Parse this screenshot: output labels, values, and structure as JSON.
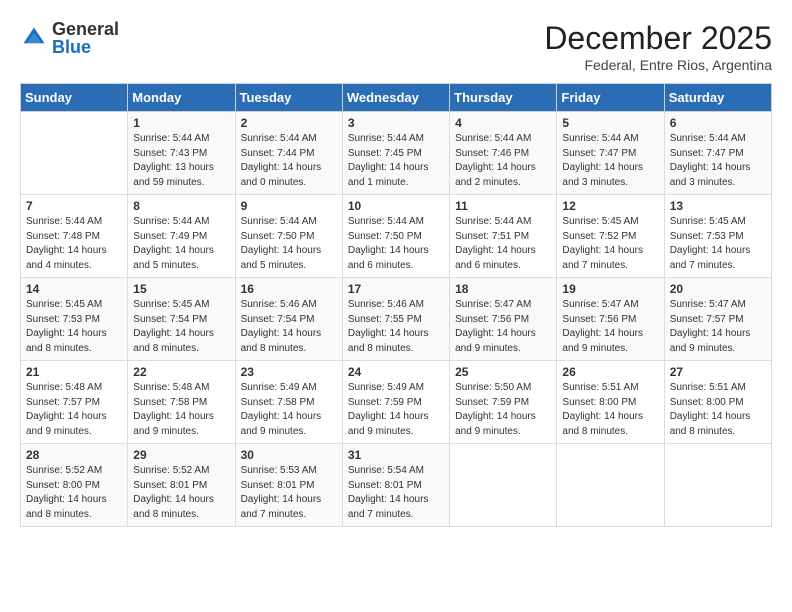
{
  "header": {
    "logo_general": "General",
    "logo_blue": "Blue",
    "month": "December 2025",
    "location": "Federal, Entre Rios, Argentina"
  },
  "days_of_week": [
    "Sunday",
    "Monday",
    "Tuesday",
    "Wednesday",
    "Thursday",
    "Friday",
    "Saturday"
  ],
  "weeks": [
    [
      {
        "day": "",
        "text": ""
      },
      {
        "day": "1",
        "text": "Sunrise: 5:44 AM\nSunset: 7:43 PM\nDaylight: 13 hours\nand 59 minutes."
      },
      {
        "day": "2",
        "text": "Sunrise: 5:44 AM\nSunset: 7:44 PM\nDaylight: 14 hours\nand 0 minutes."
      },
      {
        "day": "3",
        "text": "Sunrise: 5:44 AM\nSunset: 7:45 PM\nDaylight: 14 hours\nand 1 minute."
      },
      {
        "day": "4",
        "text": "Sunrise: 5:44 AM\nSunset: 7:46 PM\nDaylight: 14 hours\nand 2 minutes."
      },
      {
        "day": "5",
        "text": "Sunrise: 5:44 AM\nSunset: 7:47 PM\nDaylight: 14 hours\nand 3 minutes."
      },
      {
        "day": "6",
        "text": "Sunrise: 5:44 AM\nSunset: 7:47 PM\nDaylight: 14 hours\nand 3 minutes."
      }
    ],
    [
      {
        "day": "7",
        "text": "Sunrise: 5:44 AM\nSunset: 7:48 PM\nDaylight: 14 hours\nand 4 minutes."
      },
      {
        "day": "8",
        "text": "Sunrise: 5:44 AM\nSunset: 7:49 PM\nDaylight: 14 hours\nand 5 minutes."
      },
      {
        "day": "9",
        "text": "Sunrise: 5:44 AM\nSunset: 7:50 PM\nDaylight: 14 hours\nand 5 minutes."
      },
      {
        "day": "10",
        "text": "Sunrise: 5:44 AM\nSunset: 7:50 PM\nDaylight: 14 hours\nand 6 minutes."
      },
      {
        "day": "11",
        "text": "Sunrise: 5:44 AM\nSunset: 7:51 PM\nDaylight: 14 hours\nand 6 minutes."
      },
      {
        "day": "12",
        "text": "Sunrise: 5:45 AM\nSunset: 7:52 PM\nDaylight: 14 hours\nand 7 minutes."
      },
      {
        "day": "13",
        "text": "Sunrise: 5:45 AM\nSunset: 7:53 PM\nDaylight: 14 hours\nand 7 minutes."
      }
    ],
    [
      {
        "day": "14",
        "text": "Sunrise: 5:45 AM\nSunset: 7:53 PM\nDaylight: 14 hours\nand 8 minutes."
      },
      {
        "day": "15",
        "text": "Sunrise: 5:45 AM\nSunset: 7:54 PM\nDaylight: 14 hours\nand 8 minutes."
      },
      {
        "day": "16",
        "text": "Sunrise: 5:46 AM\nSunset: 7:54 PM\nDaylight: 14 hours\nand 8 minutes."
      },
      {
        "day": "17",
        "text": "Sunrise: 5:46 AM\nSunset: 7:55 PM\nDaylight: 14 hours\nand 8 minutes."
      },
      {
        "day": "18",
        "text": "Sunrise: 5:47 AM\nSunset: 7:56 PM\nDaylight: 14 hours\nand 9 minutes."
      },
      {
        "day": "19",
        "text": "Sunrise: 5:47 AM\nSunset: 7:56 PM\nDaylight: 14 hours\nand 9 minutes."
      },
      {
        "day": "20",
        "text": "Sunrise: 5:47 AM\nSunset: 7:57 PM\nDaylight: 14 hours\nand 9 minutes."
      }
    ],
    [
      {
        "day": "21",
        "text": "Sunrise: 5:48 AM\nSunset: 7:57 PM\nDaylight: 14 hours\nand 9 minutes."
      },
      {
        "day": "22",
        "text": "Sunrise: 5:48 AM\nSunset: 7:58 PM\nDaylight: 14 hours\nand 9 minutes."
      },
      {
        "day": "23",
        "text": "Sunrise: 5:49 AM\nSunset: 7:58 PM\nDaylight: 14 hours\nand 9 minutes."
      },
      {
        "day": "24",
        "text": "Sunrise: 5:49 AM\nSunset: 7:59 PM\nDaylight: 14 hours\nand 9 minutes."
      },
      {
        "day": "25",
        "text": "Sunrise: 5:50 AM\nSunset: 7:59 PM\nDaylight: 14 hours\nand 9 minutes."
      },
      {
        "day": "26",
        "text": "Sunrise: 5:51 AM\nSunset: 8:00 PM\nDaylight: 14 hours\nand 8 minutes."
      },
      {
        "day": "27",
        "text": "Sunrise: 5:51 AM\nSunset: 8:00 PM\nDaylight: 14 hours\nand 8 minutes."
      }
    ],
    [
      {
        "day": "28",
        "text": "Sunrise: 5:52 AM\nSunset: 8:00 PM\nDaylight: 14 hours\nand 8 minutes."
      },
      {
        "day": "29",
        "text": "Sunrise: 5:52 AM\nSunset: 8:01 PM\nDaylight: 14 hours\nand 8 minutes."
      },
      {
        "day": "30",
        "text": "Sunrise: 5:53 AM\nSunset: 8:01 PM\nDaylight: 14 hours\nand 7 minutes."
      },
      {
        "day": "31",
        "text": "Sunrise: 5:54 AM\nSunset: 8:01 PM\nDaylight: 14 hours\nand 7 minutes."
      },
      {
        "day": "",
        "text": ""
      },
      {
        "day": "",
        "text": ""
      },
      {
        "day": "",
        "text": ""
      }
    ]
  ]
}
